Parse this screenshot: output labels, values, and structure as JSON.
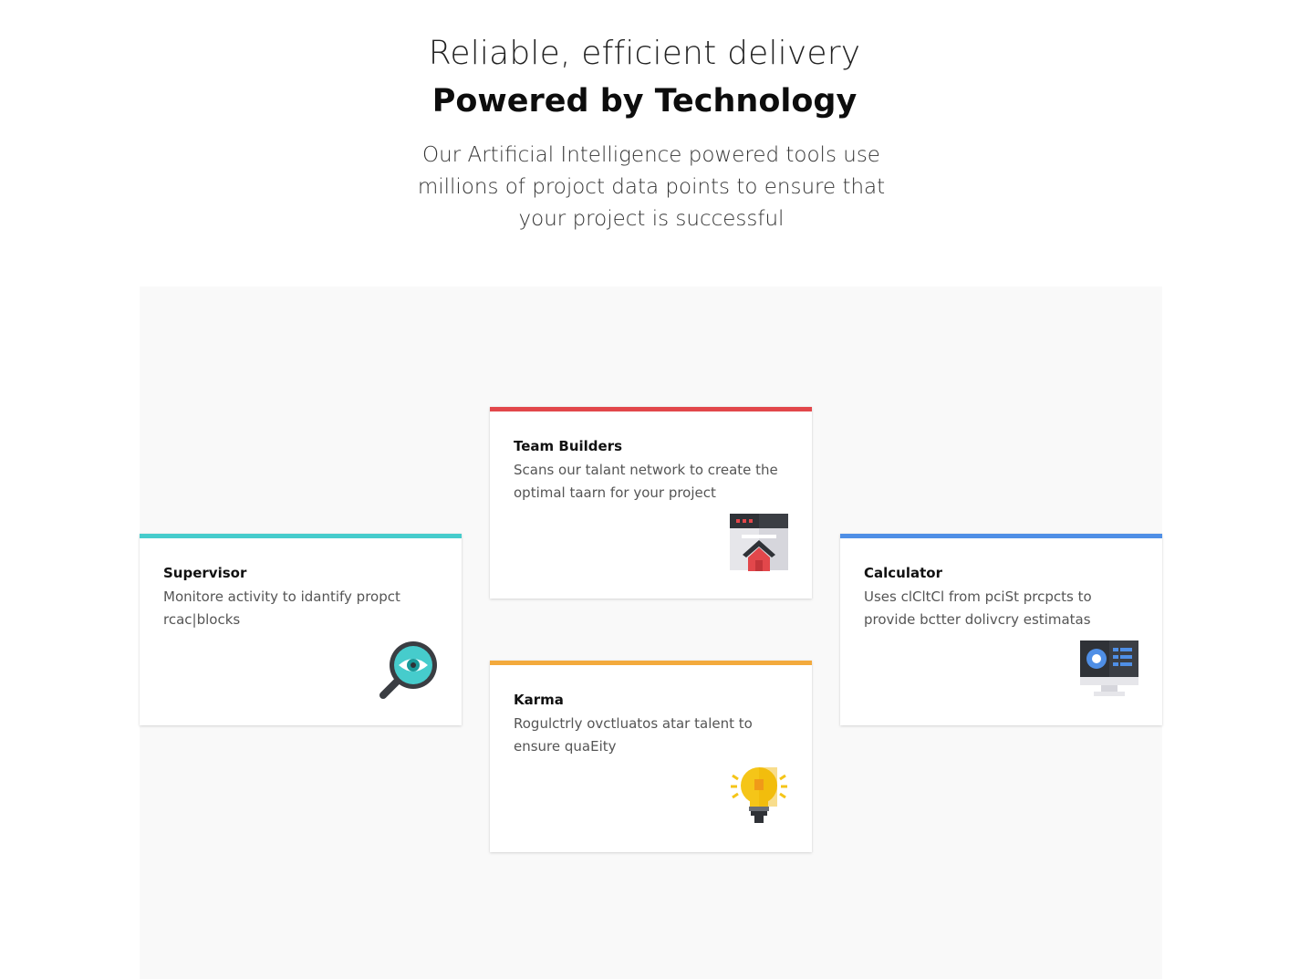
{
  "header": {
    "subtitle": "Reliable, efficient delivery",
    "title": "Powered by Technology",
    "lead": "Our Artificial Intelligence powered tools use millions of projoct data points to ensure that your project is successful"
  },
  "cards": {
    "team": {
      "name": "Team Builders",
      "description": "Scans our talant network to create the optimal taarn for your project",
      "accent": "#e2474b",
      "icon": "browser-home-icon"
    },
    "supervisor": {
      "name": "Supervisor",
      "description": "Monitore activity to idantify propct rcac|blocks",
      "accent": "#46cccc",
      "icon": "magnifier-eye-icon"
    },
    "calculator": {
      "name": "Calculator",
      "description": "Uses clCltCl from pciSt prcpcts to provide bctter dolivcry estimatas",
      "accent": "#4f8fe6",
      "icon": "monitor-dashboard-icon"
    },
    "karma": {
      "name": "Karma",
      "description": "Rogulctrly ovctluatos atar talent to ensure quaEity",
      "accent": "#f3aa3d",
      "icon": "lightbulb-icon"
    }
  }
}
